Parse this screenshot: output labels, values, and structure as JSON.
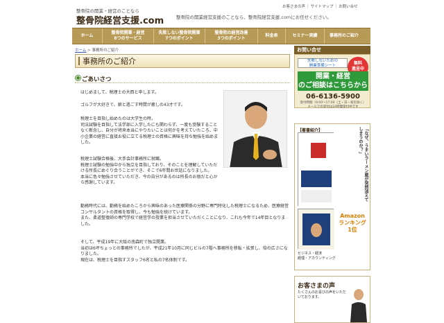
{
  "header": {
    "tagline": "整骨院の開業・経営のことなら",
    "logo": "整骨院経営支援.com",
    "description": "整骨院の開業経営支援のことなら、整骨院経営支援.comにお任せください。",
    "links": [
      "お客さまの声",
      "サイトマップ",
      "お問い合せ"
    ]
  },
  "nav": [
    {
      "label": "ホーム"
    },
    {
      "label": "整骨院開業・経営\n8つのサービス"
    },
    {
      "label": "失敗しない整骨院開業\n7つのポイント"
    },
    {
      "label": "整骨院の経営改善\n3つのポイント"
    },
    {
      "label": "料金表"
    },
    {
      "label": "セミナー実績"
    },
    {
      "label": "事務所のご紹介"
    }
  ],
  "breadcrumb": {
    "home": "ホーム",
    "sep": " > ",
    "current": "事務所のご紹介"
  },
  "main": {
    "title": "事務所のご紹介",
    "section": "ごあいさつ",
    "paragraphs": [
      "はじめまして、税理士の大西と申します。",
      "ゴルフが大好きで、娘と過ごす時間が癒しの43才です。",
      "税理士を目指し始めたのは大学生の時。\n司法試験を目指して法学部に入学したにも関わらず、一度も受験することなく断念し、自分が将来本当にやりたいことは何かを考えていたころ、中小企業の経営に直接お役に立てる税理士の資格に興味を持ち勉強を始めました。",
      "税理士試験合格後、大手会計事務所に就職。\n税理士試験の勉強中から独立を目指しており、そのことを理解していただける所長にめぐり合うことができ、そこで6年間お世話になりました。\n本当に色々勉強させていただき、今の自分があるのは所長のお陰だと心から感謝しています。",
      "勤務時代には、勤務を始めたころから興味のあった医療関係の分野に専門特化した税理士になるため、医療経営コンサルタントの資格を取得し、今も勉強を続けています。\nまた、柔道整復師の専門学校で経営学の授業を担当させていただくことになり、これも今年で14年目となりました。",
      "そして、平成19年に大阪の南森町で独立開業。\n当初は6坪ちょっとの事務所でしたが、平成21年10月に同じビルの7階へ事務所を移転・拡張し、倍の広さになりました。\n現在は、税理士を目指すスタッフ6名と私の7名体制です。"
    ]
  },
  "contact": {
    "heading": "お問い合せ",
    "top": "失敗しないための\n開業準備シート",
    "badge": "無料\n進呈中",
    "cta": "開業・経営\nのご相談はこちらから",
    "tel": "06-6136-5900",
    "hours": "受付時間（9:00～17:00（土・日・祝を除く）\nメールでの受付は24時間受付中です"
  },
  "book": {
    "heading": "【著書紹介】",
    "vtitle": "「なぜ、うまいラーメン屋が突然消えてしまうのか？」",
    "amazon": "Amazon\nランキング\n1位",
    "caption": "ビジネス・経済\n経理・アカウンティング"
  },
  "voice": {
    "title": "お客さまの声",
    "text": "たくさんのお喜びの声をいただいております。"
  }
}
